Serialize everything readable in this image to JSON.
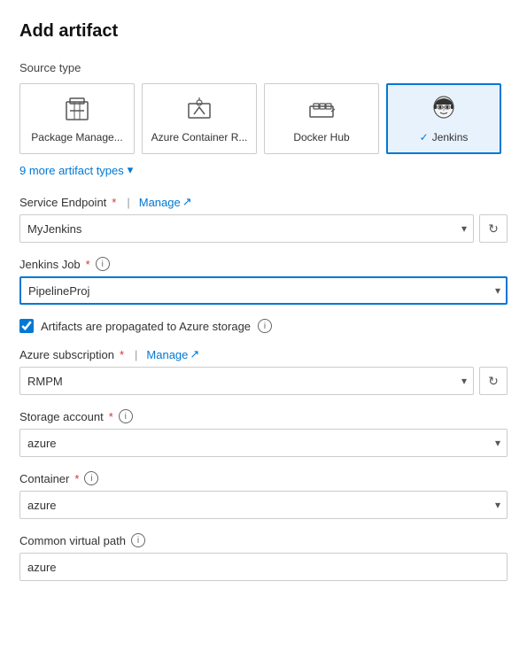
{
  "page": {
    "title": "Add artifact"
  },
  "source_type_section": {
    "label": "Source type"
  },
  "source_types": [
    {
      "id": "package-manager",
      "label": "Package Manage...",
      "selected": false,
      "icon": "package"
    },
    {
      "id": "azure-container",
      "label": "Azure Container R...",
      "selected": false,
      "icon": "azure-container"
    },
    {
      "id": "docker-hub",
      "label": "Docker Hub",
      "selected": false,
      "icon": "docker"
    },
    {
      "id": "jenkins",
      "label": "Jenkins",
      "selected": true,
      "icon": "jenkins"
    }
  ],
  "more_artifacts": {
    "text": "9 more artifact types",
    "chevron": "▾"
  },
  "service_endpoint": {
    "label": "Service Endpoint",
    "required": true,
    "manage_label": "Manage",
    "manage_icon": "↗",
    "value": "MyJenkins",
    "options": [
      "MyJenkins"
    ]
  },
  "jenkins_job": {
    "label": "Jenkins Job",
    "required": true,
    "value": "PipelineProj",
    "options": [
      "PipelineProj"
    ]
  },
  "checkbox": {
    "label": "Artifacts are propagated to Azure storage",
    "checked": true
  },
  "azure_subscription": {
    "label": "Azure subscription",
    "required": true,
    "manage_label": "Manage",
    "manage_icon": "↗",
    "value": "RMPM",
    "options": [
      "RMPM"
    ]
  },
  "storage_account": {
    "label": "Storage account",
    "required": true,
    "value": "azure",
    "options": [
      "azure"
    ]
  },
  "container": {
    "label": "Container",
    "required": true,
    "value": "azure",
    "options": [
      "azure"
    ]
  },
  "common_virtual_path": {
    "label": "Common virtual path",
    "value": "azure"
  }
}
